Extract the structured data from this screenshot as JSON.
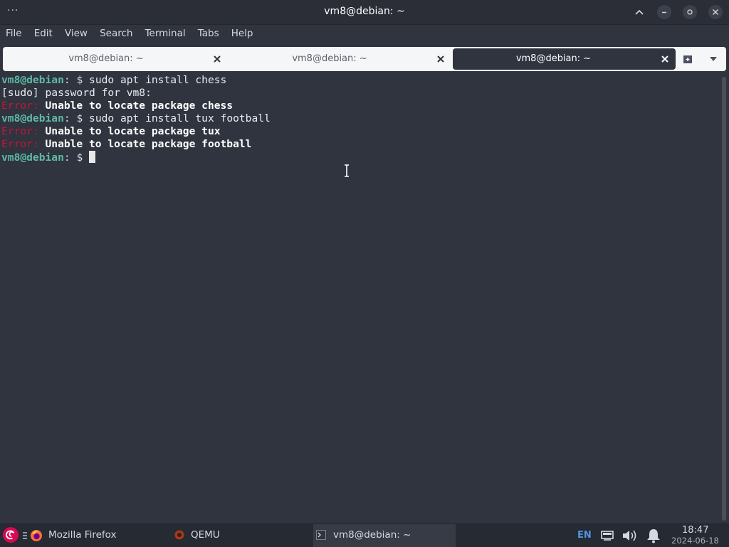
{
  "window": {
    "title": "vm8@debian: ~",
    "menu_dots": "···"
  },
  "menubar": {
    "items": [
      "File",
      "Edit",
      "View",
      "Search",
      "Terminal",
      "Tabs",
      "Help"
    ]
  },
  "tabs": [
    {
      "label": "vm8@debian: ~",
      "active": false
    },
    {
      "label": "vm8@debian: ~",
      "active": false
    },
    {
      "label": "vm8@debian: ~",
      "active": true
    }
  ],
  "terminal": {
    "lines": [
      {
        "user": "vm8@debian",
        "sep": ": $ ",
        "cmd": "sudo apt install chess"
      },
      {
        "text": "[sudo] password for vm8:"
      },
      {
        "error": "Error:",
        "msg": " Unable to locate package chess"
      },
      {
        "user": "vm8@debian",
        "sep": ": $ ",
        "cmd": "sudo apt install tux football"
      },
      {
        "error": "Error:",
        "msg": " Unable to locate package tux"
      },
      {
        "error": "Error:",
        "msg": " Unable to locate package football"
      },
      {
        "user": "vm8@debian",
        "sep": ": $ ",
        "cmd": ""
      }
    ]
  },
  "taskbar": {
    "tasks": [
      {
        "label": "Mozilla Firefox",
        "icon": "firefox-icon"
      },
      {
        "label": "QEMU",
        "icon": "qemu-icon"
      },
      {
        "label": "vm8@debian: ~",
        "icon": "terminal-icon",
        "active": true
      }
    ],
    "language": "EN",
    "time": "18:47",
    "date": "2024-06-18"
  },
  "colors": {
    "prompt_user": "#5fb9a4",
    "error": "#c0163a",
    "accent": "#5294e2",
    "debian": "#d70a53"
  }
}
